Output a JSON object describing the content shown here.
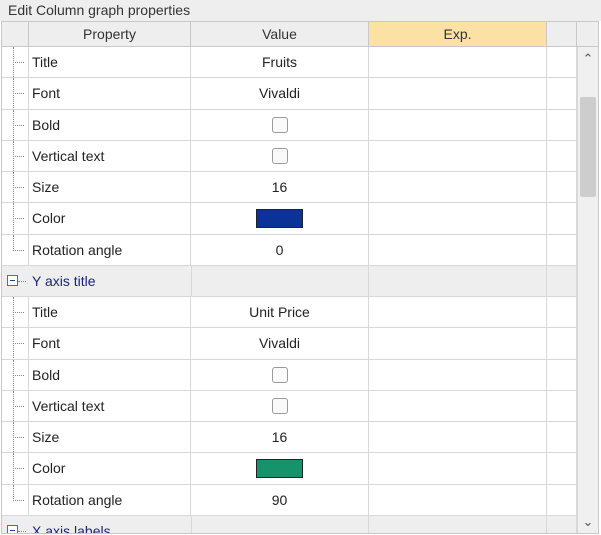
{
  "window": {
    "title": "Edit Column graph properties"
  },
  "columns": {
    "property": "Property",
    "value": "Value",
    "exp": "Exp."
  },
  "rows": [
    {
      "type": "prop",
      "label": "Title",
      "value": "Fruits"
    },
    {
      "type": "prop",
      "label": "Font",
      "value": "Vivaldi"
    },
    {
      "type": "check",
      "label": "Bold",
      "checked": false
    },
    {
      "type": "check",
      "label": "Vertical text",
      "checked": false
    },
    {
      "type": "prop",
      "label": "Size",
      "value": "16"
    },
    {
      "type": "color",
      "label": "Color",
      "color": "#0b3296"
    },
    {
      "type": "prop",
      "label": "Rotation angle",
      "value": "0",
      "last": true
    },
    {
      "type": "section",
      "label": "Y axis title"
    },
    {
      "type": "prop",
      "label": "Title",
      "value": "Unit Price"
    },
    {
      "type": "prop",
      "label": "Font",
      "value": "Vivaldi"
    },
    {
      "type": "check",
      "label": "Bold",
      "checked": false
    },
    {
      "type": "check",
      "label": "Vertical text",
      "checked": false
    },
    {
      "type": "prop",
      "label": "Size",
      "value": "16"
    },
    {
      "type": "color",
      "label": "Color",
      "color": "#15936a"
    },
    {
      "type": "prop",
      "label": "Rotation angle",
      "value": "90",
      "last": true
    },
    {
      "type": "section",
      "label": "X axis labels"
    }
  ],
  "icons": {
    "expander": "collapse-box-icon",
    "scroll_up": "chevron-up-icon",
    "scroll_down": "chevron-down-icon"
  },
  "colors": {
    "exp_header": "#fbe2a4",
    "section_text": "#1a237e"
  }
}
